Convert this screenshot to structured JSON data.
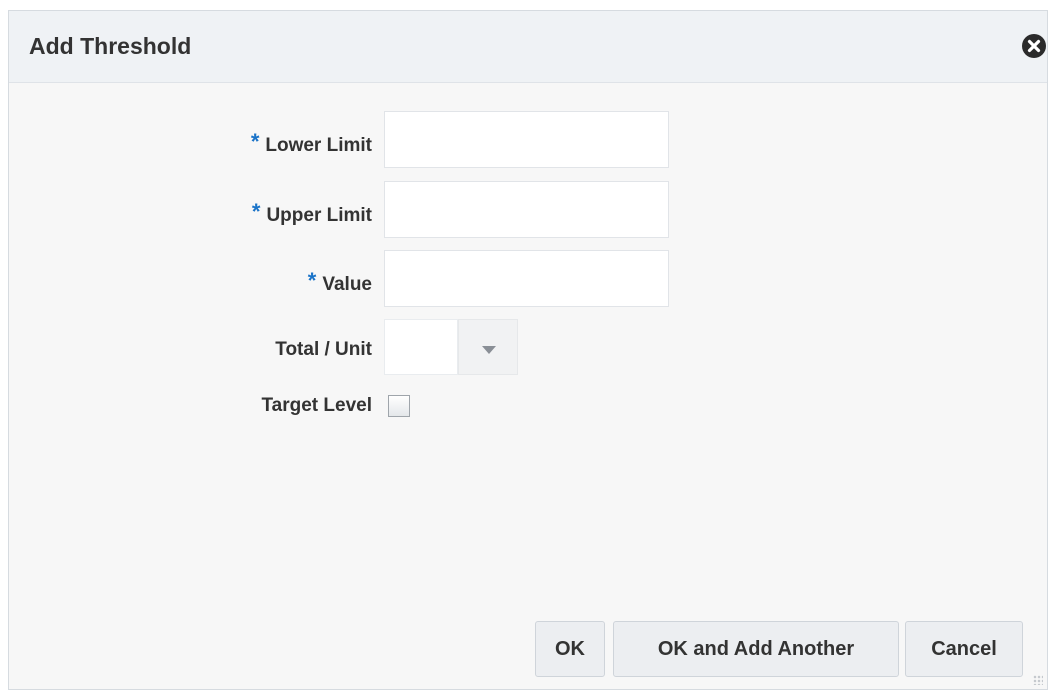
{
  "dialog": {
    "title": "Add Threshold"
  },
  "form": {
    "lower_limit": {
      "label": "Lower Limit",
      "required_marker": "*",
      "value": ""
    },
    "upper_limit": {
      "label": "Upper Limit",
      "required_marker": "*",
      "value": ""
    },
    "value": {
      "label": "Value",
      "required_marker": "*",
      "value": ""
    },
    "total_unit": {
      "label": "Total / Unit",
      "selected": ""
    },
    "target_level": {
      "label": "Target Level",
      "checked": false
    }
  },
  "buttons": {
    "ok": "OK",
    "ok_add_another": "OK and Add Another",
    "cancel": "Cancel"
  },
  "colors": {
    "required_marker": "#1a73c8",
    "header_bg": "#eff2f5",
    "body_bg": "#f7f7f7",
    "text": "#333333"
  },
  "icons": {
    "close": "close-circle-x-icon",
    "dropdown": "chevron-down-icon",
    "resize": "resize-grip-icon"
  }
}
